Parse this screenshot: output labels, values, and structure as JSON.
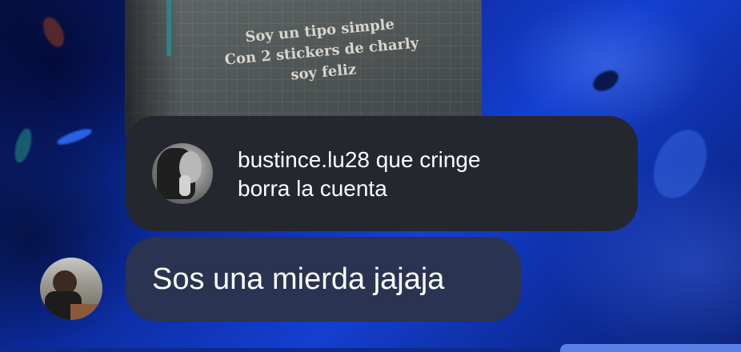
{
  "story_preview": {
    "lines": [
      "Soy un tipo simple",
      "Con 2 stickers de charly",
      "soy feliz"
    ]
  },
  "reply": {
    "username": "bustince.lu28",
    "text_line1_rest": " que cringe",
    "text_line2": "borra la cuenta"
  },
  "message": {
    "text": "Sos una mierda jajaja"
  },
  "colors": {
    "reply_bubble": "#24272e",
    "message_bubble": "#2a3352",
    "background": "#0d2a8e"
  }
}
